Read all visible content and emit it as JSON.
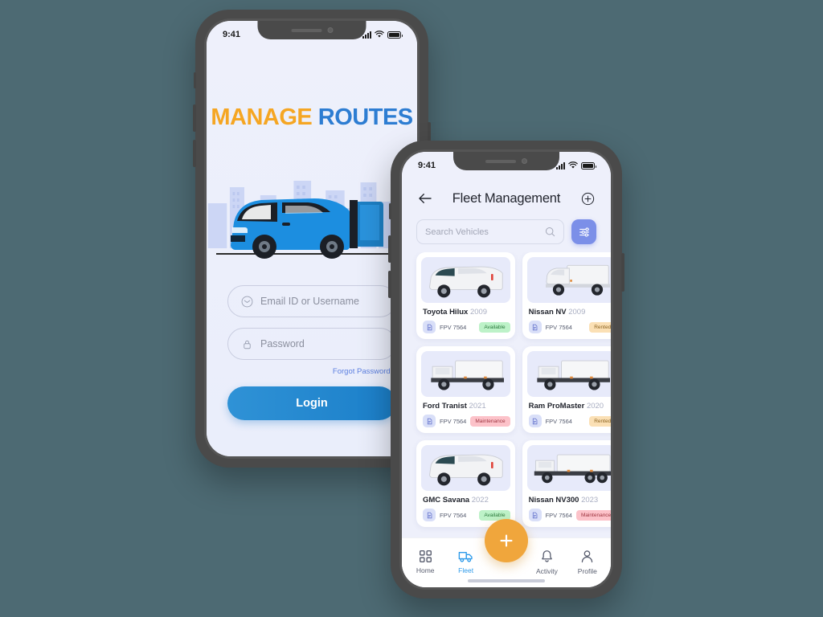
{
  "background_color": "#4d6a73",
  "login_phone": {
    "status_bar": {
      "time": "9:41",
      "signal_icon": "signal-bars-icon",
      "wifi_icon": "wifi-icon",
      "battery_icon": "battery-icon"
    },
    "brand": {
      "word1": "MANAGE",
      "word2": "ROUTES",
      "word1_color": "#F5A623",
      "word2_color": "#2D7DD2"
    },
    "illustration": {
      "name": "delivery-van-city-illustration",
      "van_color": "#1c8ee0",
      "skyline_color": "#c7d2f2"
    },
    "form": {
      "email": {
        "placeholder": "Email ID or Username",
        "value": "",
        "icon": "envelope-icon"
      },
      "password": {
        "placeholder": "Password",
        "value": "",
        "icon": "lock-icon"
      },
      "forgot_label": "Forgot Password?",
      "login_label": "Login",
      "login_color": "#1b7fc9"
    }
  },
  "fleet_phone": {
    "status_bar": {
      "time": "9:41",
      "signal_icon": "signal-bars-icon",
      "wifi_icon": "wifi-icon",
      "battery_icon": "battery-icon"
    },
    "header": {
      "back_icon": "arrow-left-icon",
      "title": "Fleet Management",
      "add_icon": "plus-circle-icon"
    },
    "search": {
      "placeholder": "Search Vehicles",
      "value": "",
      "icon": "search-icon",
      "filter_icon": "filter-sliders-icon",
      "filter_color": "#7b8fe8"
    },
    "vehicles": [
      {
        "name": "Toyota Hilux",
        "year": "2009",
        "plate": "FPV 7564",
        "plate_icon": "vehicle-document-icon",
        "status": "Available",
        "status_class": "available",
        "image": "white-van-icon"
      },
      {
        "name": "Nissan NV",
        "year": "2009",
        "plate": "FPV 7564",
        "plate_icon": "vehicle-document-icon",
        "status": "Rented",
        "status_class": "rented",
        "image": "white-box-truck-icon"
      },
      {
        "name": "Ford Tranist",
        "year": "2021",
        "plate": "FPV 7564",
        "plate_icon": "vehicle-document-icon",
        "status": "Maintenance",
        "status_class": "maintenance",
        "image": "white-cab-truck-icon"
      },
      {
        "name": "Ram ProMaster",
        "year": "2020",
        "plate": "FPV 7564",
        "plate_icon": "vehicle-document-icon",
        "status": "Rented",
        "status_class": "rented",
        "image": "white-cab-truck-icon"
      },
      {
        "name": "GMC Savana",
        "year": "2022",
        "plate": "FPV 7564",
        "plate_icon": "vehicle-document-icon",
        "status": "Available",
        "status_class": "available",
        "image": "white-van-icon"
      },
      {
        "name": "Nissan NV300",
        "year": "2023",
        "plate": "FPV 7564",
        "plate_icon": "vehicle-document-icon",
        "status": "Maintenance",
        "status_class": "maintenance",
        "image": "white-long-truck-icon"
      }
    ],
    "tabbar": {
      "fab_icon": "plus-icon",
      "fab_color": "#f0a63c",
      "active_color": "#2f9bea",
      "items": [
        {
          "label": "Home",
          "icon": "grid-icon",
          "active": false
        },
        {
          "label": "Fleet",
          "icon": "truck-icon",
          "active": true
        },
        {
          "label": "Activity",
          "icon": "bell-icon",
          "active": false
        },
        {
          "label": "Profile",
          "icon": "person-icon",
          "active": false
        }
      ]
    }
  }
}
